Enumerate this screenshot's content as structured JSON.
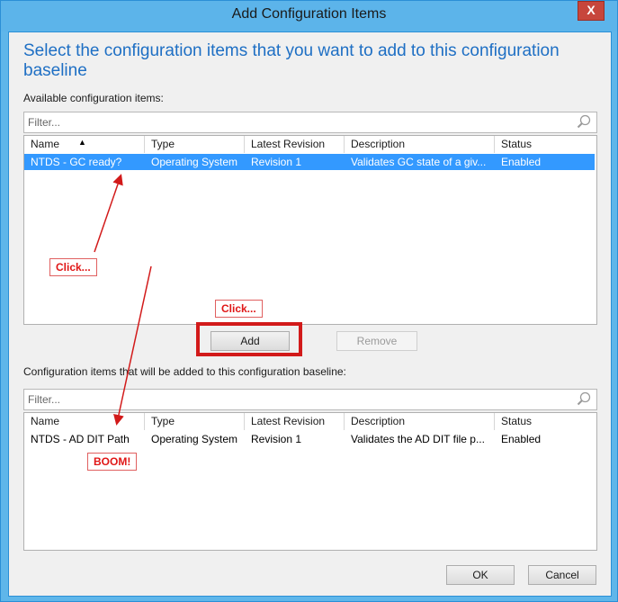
{
  "window": {
    "title": "Add Configuration Items",
    "close_label": "X"
  },
  "heading": "Select the configuration items that you want to add to this configuration baseline",
  "available": {
    "label": "Available configuration items:",
    "filter_placeholder": "Filter...",
    "columns": [
      "Name",
      "Type",
      "Latest Revision",
      "Description",
      "Status"
    ],
    "rows": [
      {
        "name": "NTDS - GC ready?",
        "type": "Operating System",
        "revision": "Revision 1",
        "description": "Validates GC state of a giv...",
        "status": "Enabled"
      }
    ]
  },
  "buttons": {
    "add": "Add",
    "remove": "Remove",
    "ok": "OK",
    "cancel": "Cancel"
  },
  "added": {
    "label": "Configuration items that will be added to this configuration baseline:",
    "filter_placeholder": "Filter...",
    "columns": [
      "Name",
      "Type",
      "Latest Revision",
      "Description",
      "Status"
    ],
    "rows": [
      {
        "name": "NTDS - AD DIT Path",
        "type": "Operating System",
        "revision": "Revision 1",
        "description": "Validates the AD DIT file p...",
        "status": "Enabled"
      }
    ]
  },
  "annotations": {
    "click1": "Click...",
    "click2": "Click...",
    "boom": "BOOM!"
  },
  "colors": {
    "accent": "#1e6fc4",
    "selection": "#3399ff",
    "annotation_red": "#d21a1a"
  }
}
